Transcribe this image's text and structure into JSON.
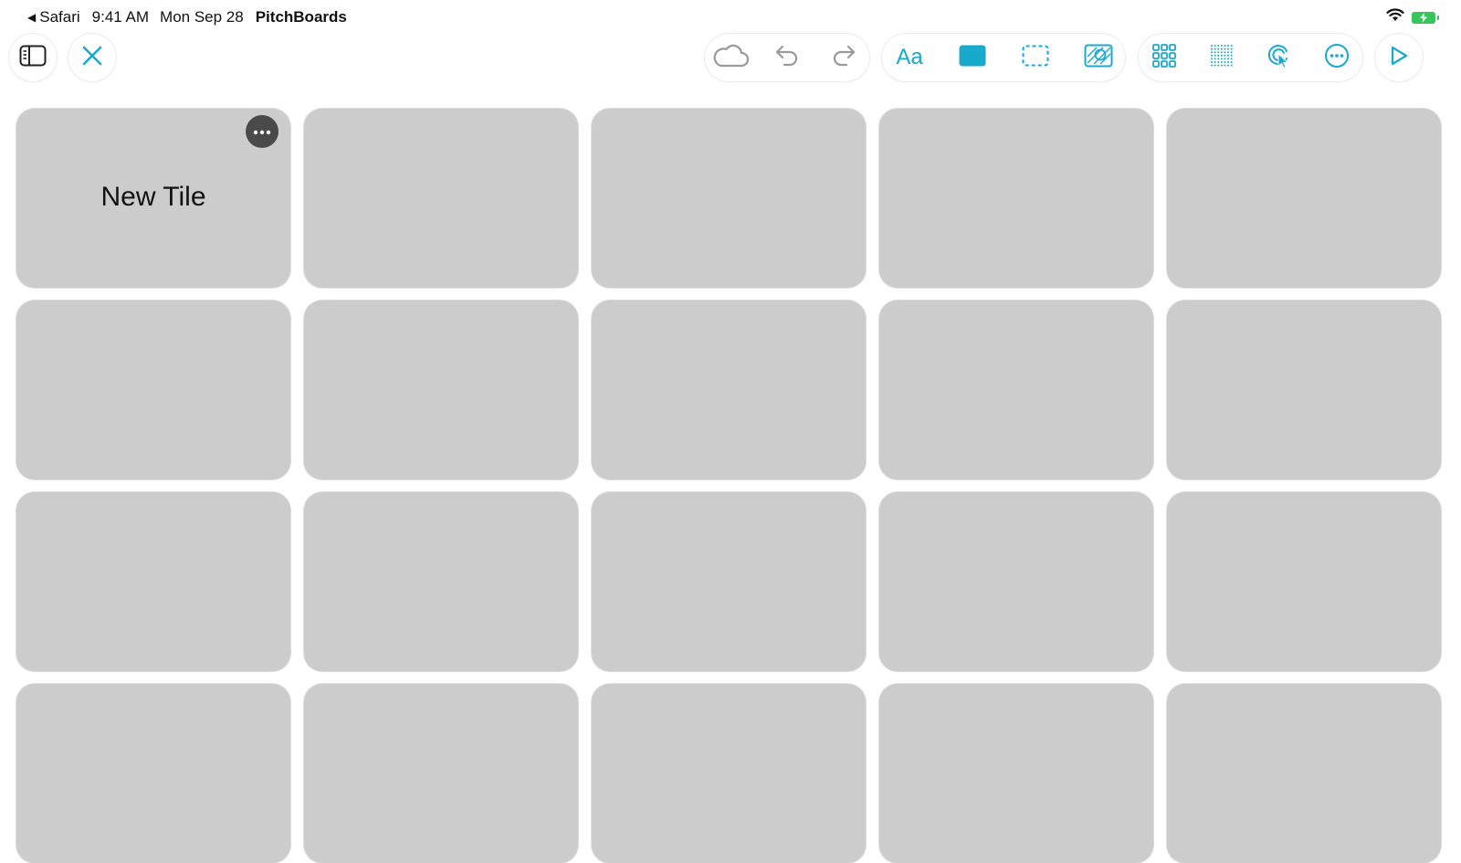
{
  "status_bar": {
    "back_app": "Safari",
    "time": "9:41 AM",
    "date": "Mon Sep 28",
    "app_name": "PitchBoards",
    "icons": [
      "wifi-icon",
      "battery-charging-icon"
    ]
  },
  "toolbar": {
    "left": [
      {
        "name": "sidebar-toggle-button",
        "icon": "sidebar-icon"
      },
      {
        "name": "close-button",
        "icon": "close-icon"
      }
    ],
    "group_edit": [
      "cloud-icon",
      "undo-icon",
      "redo-icon"
    ],
    "group_style": {
      "text_label": "Aa",
      "icons": [
        "fill-icon",
        "dashed-border-icon",
        "image-icon"
      ]
    },
    "group_view": [
      "grid-icon",
      "dot-grid-icon",
      "touch-pointer-icon",
      "more-icon"
    ],
    "play_icon": "play-icon",
    "colors": {
      "accent": "#18a9cc",
      "inactive": "#9a9a9a"
    }
  },
  "tiles": {
    "columns": 5,
    "rows_visible": 4,
    "first_tile_label": "New Tile",
    "tile_color": "#cccccc",
    "menu_icon": "more-horizontal-icon"
  }
}
